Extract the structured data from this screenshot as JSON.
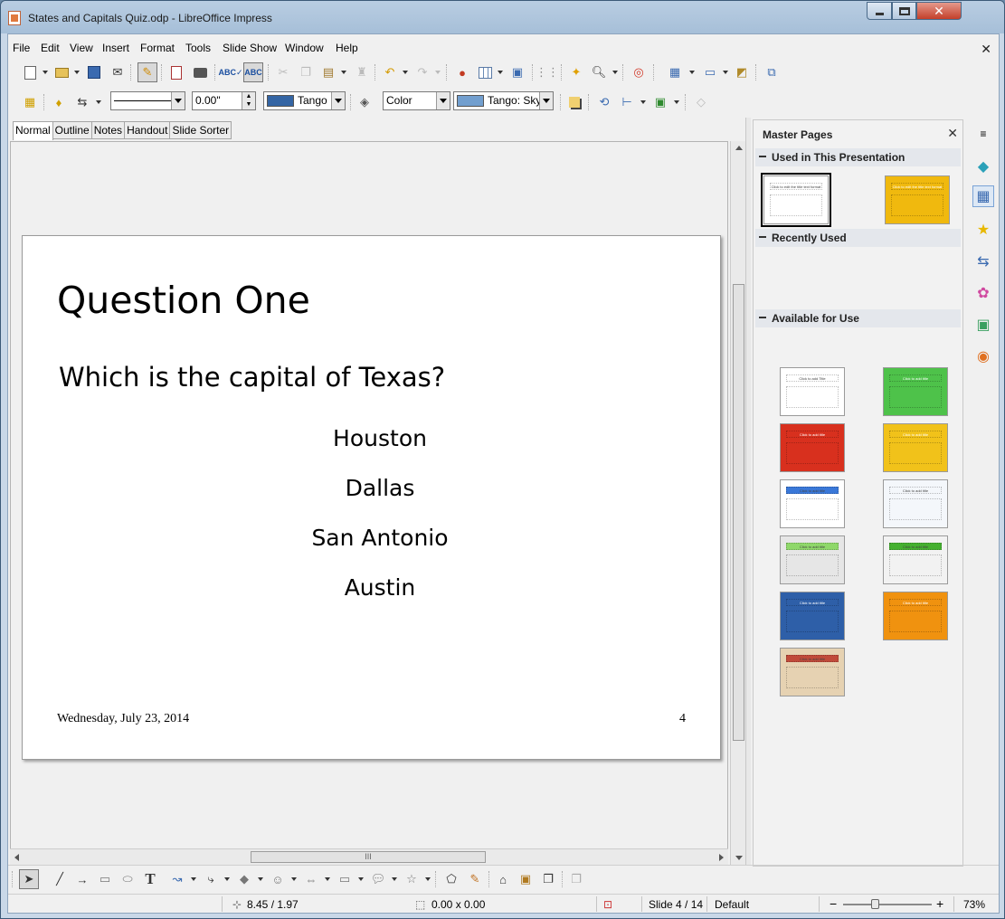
{
  "window": {
    "title": "States and Capitals Quiz.odp - LibreOffice Impress"
  },
  "menu": [
    "File",
    "Edit",
    "View",
    "Insert",
    "Format",
    "Tools",
    "Slide Show",
    "Window",
    "Help"
  ],
  "format_toolbar": {
    "line_width": "0.00\"",
    "line_color": "Tango",
    "line_color_hex": "#3465a4",
    "area_style": "Color",
    "area_color": "Tango: Sky",
    "area_color_hex": "#729fcf"
  },
  "view_tabs": [
    {
      "label": "Normal",
      "active": true
    },
    {
      "label": "Outline",
      "active": false
    },
    {
      "label": "Notes",
      "active": false
    },
    {
      "label": "Handout",
      "active": false
    },
    {
      "label": "Slide Sorter",
      "active": false
    }
  ],
  "slide": {
    "title": "Question One",
    "question": "Which is the capital of Texas?",
    "answers": [
      "Houston",
      "Dallas",
      "San Antonio",
      "Austin"
    ],
    "footer_date": "Wednesday, July 23, 2014",
    "slide_number": "4"
  },
  "master_pages": {
    "title": "Master Pages",
    "used_header": "Used in This Presentation",
    "recent_header": "Recently Used",
    "available_header": "Available for Use",
    "used": [
      {
        "name": "default-white",
        "bg": "#ffffff",
        "title_text": "Click to edit the title text format"
      },
      {
        "name": "yellow",
        "bg": "#f0b90e",
        "title_text": "Click to edit the title text format"
      }
    ],
    "available": [
      {
        "name": "white",
        "bg": "#ffffff",
        "title_text": "Click to add Title"
      },
      {
        "name": "green",
        "bg": "#4ec24a",
        "title_text": "Click to add title"
      },
      {
        "name": "red",
        "bg": "#d8301e",
        "title_text": "Click to add title"
      },
      {
        "name": "yellow-2",
        "bg": "#f1c21a",
        "title_text": "Click to add title"
      },
      {
        "name": "blue-bar",
        "bg": "#ffffff",
        "accent": "#3a78d8",
        "title_text": "Click to add title"
      },
      {
        "name": "light-pattern",
        "bg": "#f4f7fb",
        "title_text": "Click to add title"
      },
      {
        "name": "green-frame",
        "bg": "#e6e6e6",
        "accent": "#8fd86a",
        "title_text": "Click to add title"
      },
      {
        "name": "green-top",
        "bg": "#f2f2f2",
        "accent": "#45b030",
        "title_text": "Click to add title"
      },
      {
        "name": "dark-blue",
        "bg": "#2e5fa8",
        "title_text": "Click to add title"
      },
      {
        "name": "orange",
        "bg": "#f0920f",
        "title_text": "Click to add title"
      },
      {
        "name": "tan",
        "bg": "#e6d2b2",
        "accent": "#c04a3a",
        "title_text": "Click to add title"
      }
    ]
  },
  "status": {
    "position": "8.45 / 1.97",
    "size": "0.00 x 0.00",
    "slide": "Slide 4 / 14",
    "master": "Default",
    "zoom": "73%",
    "zoom_minus": "−",
    "zoom_plus": "+"
  }
}
